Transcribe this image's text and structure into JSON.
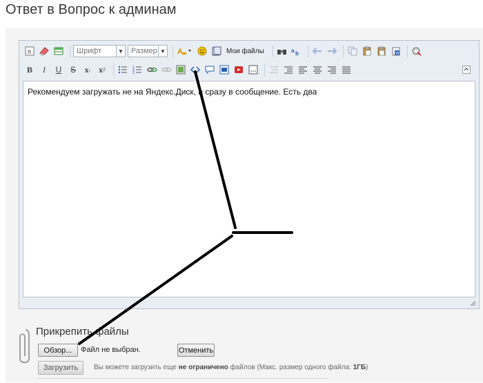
{
  "page": {
    "title": "Ответ в Вопрос к админам"
  },
  "toolbar": {
    "font_select": "Шрифт",
    "size_select": "Размер",
    "my_files": "Мои файлы",
    "bold": "B",
    "italic": "I",
    "underline": "U",
    "strike": "S",
    "subscript": "x",
    "superscript": "x"
  },
  "editor": {
    "content": "Рекомендуем загружать не на Яндекс.Диск, а сразу в сообщение. Есть два"
  },
  "attachments": {
    "label": "Прикрепить файлы",
    "browse_button": "Обзор...",
    "file_status": "Файл не выбран.",
    "cancel_button": "Отменить",
    "upload_button": "Загрузить",
    "hint_prefix": "Вы можете загрузить еще",
    "hint_limit": "не ограничено",
    "hint_middle": "файлов (Макс. размер одного файла:",
    "hint_size": "1ГБ",
    "hint_suffix": ")"
  },
  "colors": {
    "annotation": "#000000",
    "editor_bg": "#e9eef4"
  }
}
